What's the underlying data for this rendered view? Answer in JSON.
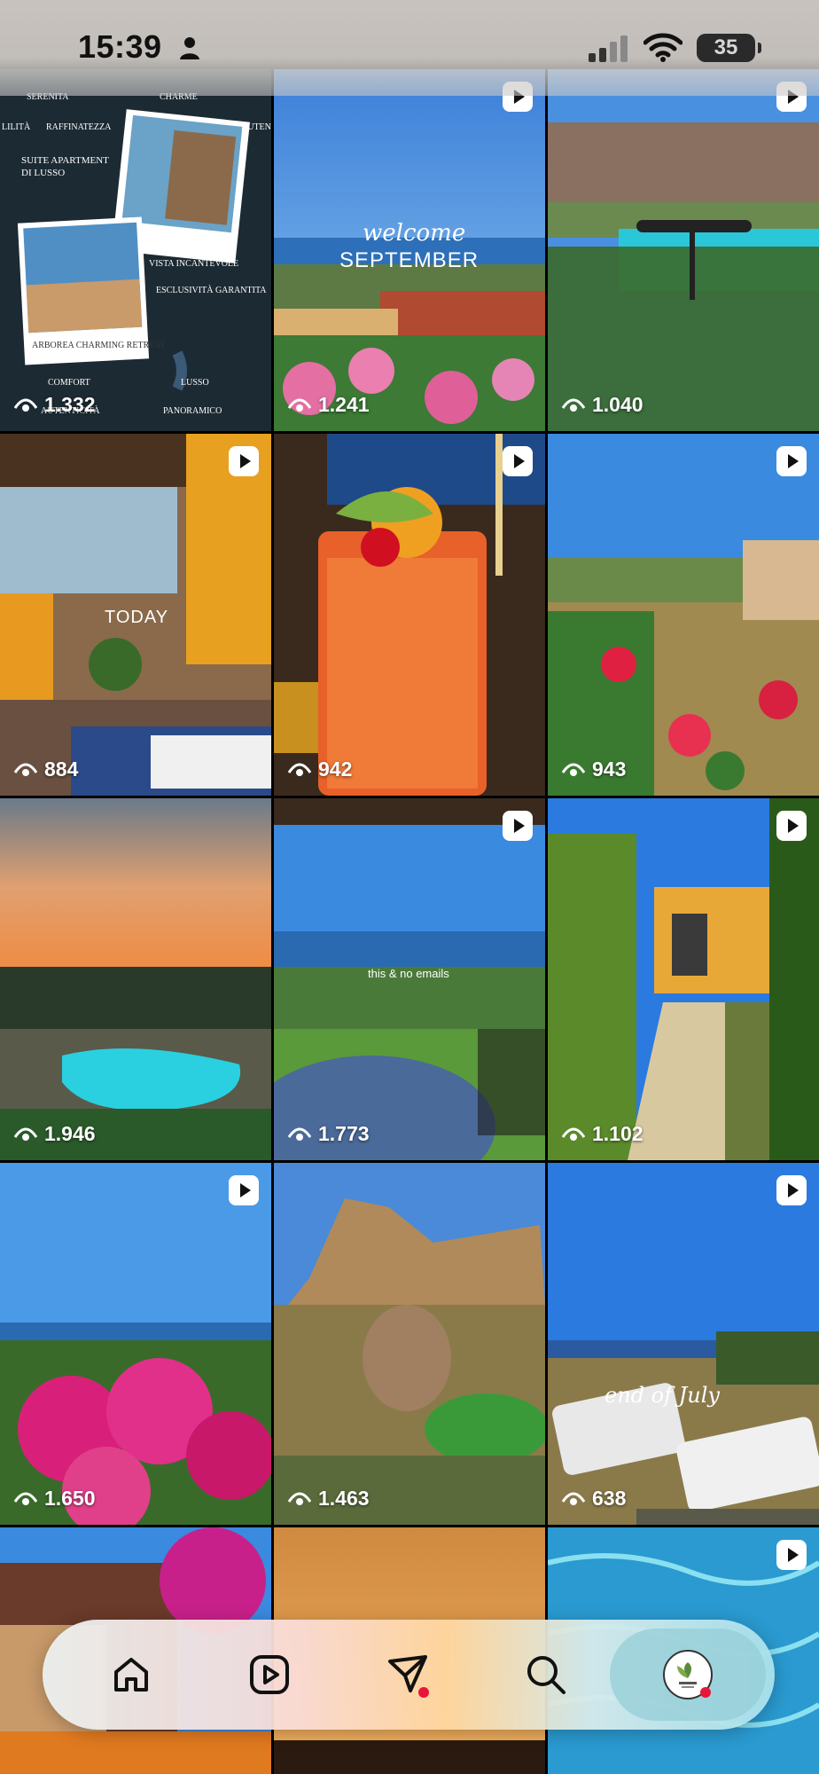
{
  "status_bar": {
    "time": "15:39",
    "battery": "35"
  },
  "grid": {
    "tiles": [
      {
        "views": "1.332",
        "is_reel": false
      },
      {
        "views": "1.241",
        "is_reel": true
      },
      {
        "views": "1.040",
        "is_reel": true
      },
      {
        "views": "884",
        "is_reel": true
      },
      {
        "views": "942",
        "is_reel": true
      },
      {
        "views": "943",
        "is_reel": true
      },
      {
        "views": "1.946",
        "is_reel": false
      },
      {
        "views": "1.773",
        "is_reel": true
      },
      {
        "views": "1.102",
        "is_reel": true
      },
      {
        "views": "1.650",
        "is_reel": true
      },
      {
        "views": "1.463",
        "is_reel": false
      },
      {
        "views": "638",
        "is_reel": true
      },
      {
        "views": "",
        "is_reel": false
      },
      {
        "views": "",
        "is_reel": false
      },
      {
        "views": "",
        "is_reel": true
      }
    ],
    "overlay_text": {
      "promo_top_left": "SERENITA",
      "promo_top_mid": "CHARME",
      "promo_top_right": "AUTENTI",
      "promo_left1": "LILITÀ",
      "promo_left2": "RAFFINATEZZA",
      "promo_suite": "SUITE APARTMENT DI LUSSO",
      "promo_orizz": "ORIZZONTI INFINITI VISTA INCANTEVOLE",
      "promo_escl": "ESCLUSIVITÀ GARANTITA",
      "promo_polaroid": "ARBOREA CHARMING RETREAT",
      "promo_comfort": "COMFORT",
      "promo_lusso": "LUSSO",
      "promo_autenticita": "AUTENTICITÀ",
      "promo_panoramico": "PANORAMICO",
      "welcome": "welcome",
      "september": "SEPTEMBER",
      "today": "TODAY",
      "emails": "this & no emails",
      "end_july": "end of July"
    }
  },
  "nav": {
    "items": [
      {
        "icon": "home-icon"
      },
      {
        "icon": "reels-icon"
      },
      {
        "icon": "send-icon",
        "badge": true
      },
      {
        "icon": "search-icon"
      },
      {
        "icon": "profile-avatar",
        "badge": true,
        "active": true
      }
    ]
  },
  "colors": {
    "notification": "#e8163a",
    "text": "#ffffff"
  }
}
